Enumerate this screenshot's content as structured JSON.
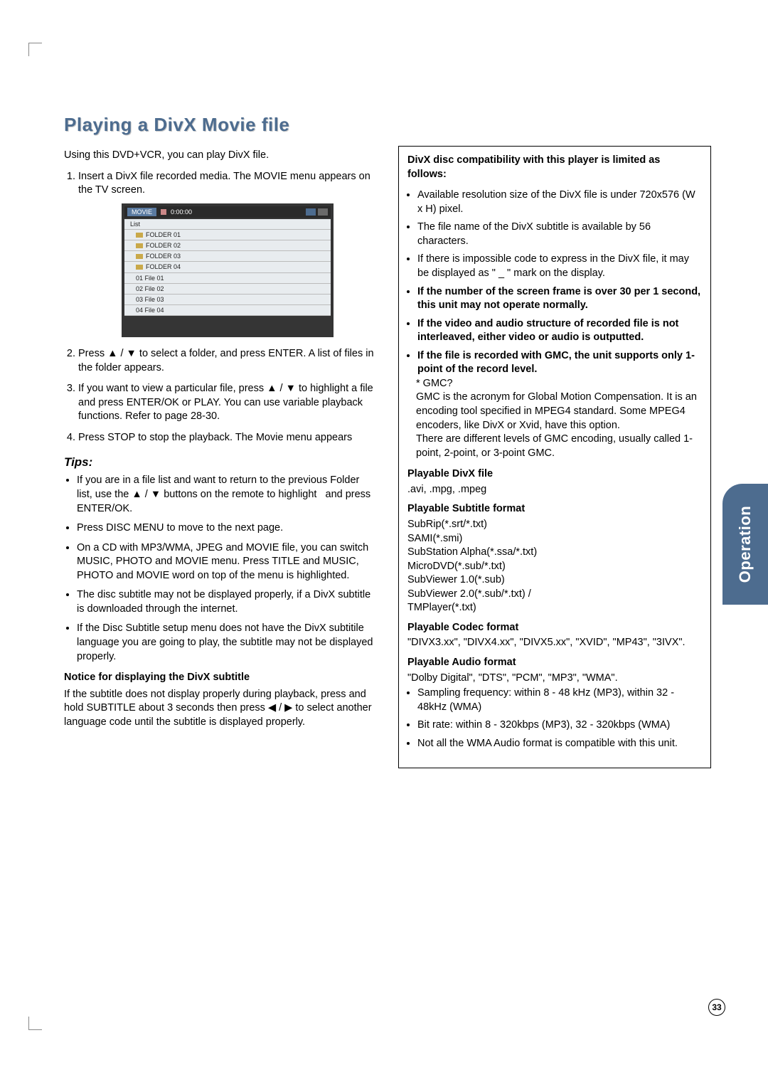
{
  "title": "Playing a DivX Movie file",
  "intro": "Using this DVD+VCR, you can play DivX file.",
  "side_tab": "Operation",
  "page_number": "33",
  "steps": [
    "Insert a DivX file recorded media. The MOVIE menu appears on the TV screen.",
    "Press ▲ / ▼ to select a folder, and press ENTER. A list of files in the folder appears.",
    "If you want to view a particular file, press ▲ / ▼ to highlight a file and press ENTER/OK or PLAY. You can use variable playback functions. Refer to page 28-30.",
    "Press STOP to stop the playback. The Movie menu appears"
  ],
  "tips_heading": "Tips:",
  "tips": [
    "If you are in a file list and want to return to the previous Folder list, use the ▲ / ▼ buttons on the remote to highlight     and press ENTER/OK.",
    "Press DISC MENU to move to the next page.",
    "On a CD with MP3/WMA, JPEG and MOVIE file, you can switch MUSIC, PHOTO and MOVIE menu. Press TITLE and MUSIC, PHOTO and MOVIE word on top of the menu is highlighted.",
    "The disc subtitle may not be displayed properly, if a DivX subtitle is downloaded through the internet.",
    "If the Disc Subtitle setup menu does not have the DivX subtitile language you are going to play, the subtitle may not be displayed properly."
  ],
  "notice_heading": "Notice for displaying the DivX subtitle",
  "notice_body": "If the subtitle does not display properly during playback, press and hold SUBTITLE about 3 seconds then press ◀ / ▶ to select another language code until the subtitle is displayed properly.",
  "compat_heading": "DivX disc compatibility with this player is limited as follows:",
  "compat_items": [
    {
      "text": "Available resolution size of the DivX file is under 720x576 (W x H) pixel.",
      "bold": false
    },
    {
      "text": "The file name of the DivX subtitle is available by 56 characters.",
      "bold": false
    },
    {
      "text": "If there is impossible code to express in the DivX file, it may be displayed as \" _ \" mark on the display.",
      "bold": false
    },
    {
      "text": "If the number of the screen frame is over 30 per 1 second, this unit may not operate normally.",
      "bold": true
    },
    {
      "text": "If the video and audio structure of recorded file is not interleaved, either video or audio is outputted.",
      "bold": true
    },
    {
      "text": "If the file is recorded with GMC, the unit supports only 1-point of the record level.",
      "bold": true
    }
  ],
  "gmc_q": "* GMC?",
  "gmc_body": "GMC is the acronym for Global Motion Compensation. It is an encoding tool specified in MPEG4 standard. Some MPEG4 encoders, like DivX or Xvid, have this option.\nThere are different levels of GMC encoding, usually called 1-point, 2-point, or 3-point GMC.",
  "play_divx_h": "Playable DivX file",
  "play_divx_b": ".avi, .mpg, .mpeg",
  "play_sub_h": "Playable Subtitle format",
  "play_sub_b": "SubRip(*.srt/*.txt)\nSAMI(*.smi)\nSubStation Alpha(*.ssa/*.txt)\nMicroDVD(*.sub/*.txt)\nSubViewer 1.0(*.sub)\nSubViewer 2.0(*.sub/*.txt) /\nTMPlayer(*.txt)",
  "play_codec_h": "Playable Codec format",
  "play_codec_b": "\"DIVX3.xx\", \"DIVX4.xx\", \"DIVX5.xx\", \"XVID\", \"MP43\", \"3IVX\".",
  "play_audio_h": "Playable Audio format",
  "play_audio_b": "\"Dolby Digital\", \"DTS\", \"PCM\", \"MP3\", \"WMA\".",
  "audio_items": [
    "Sampling frequency: within 8 - 48 kHz (MP3), within 32 - 48kHz (WMA)",
    "Bit rate: within 8 - 320kbps (MP3), 32 - 320kbps (WMA)",
    "Not all the WMA Audio format is compatible with this unit."
  ],
  "shot": {
    "title": "MOVIE",
    "count": "0:00:00",
    "list": "List",
    "rows": [
      "FOLDER 01",
      "FOLDER 02",
      "FOLDER 03",
      "FOLDER 04",
      "01  File 01",
      "02  File 02",
      "03  File 03",
      "04  File 04"
    ]
  }
}
